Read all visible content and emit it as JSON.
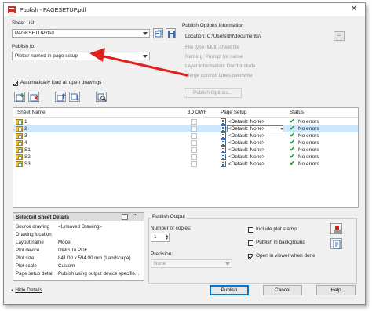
{
  "window": {
    "title": "Publish - PAGESETUP.pdf"
  },
  "sheet_list": {
    "label": "Sheet List:",
    "value": "PAGESETUP.dsd"
  },
  "publish_to": {
    "label": "Publish to:",
    "value": "Plotter named in page setup"
  },
  "auto_load": {
    "label": "Automatically load all open drawings",
    "checked": true
  },
  "publish_options": {
    "title": "Publish Options Information",
    "location": "Location:  C:\\Users\\thl\\documents\\",
    "browse_label": "...",
    "file_type": "File type: Multi-sheet file",
    "naming": "Naming: Prompt for name",
    "layer_info": "Layer information: Don't include",
    "merge_control": "Merge control: Lines overwrite",
    "button_label": "Publish Options..."
  },
  "table": {
    "headers": {
      "sheet_name": "Sheet Name",
      "dwf3d": "3D DWF",
      "page_setup": "Page Setup",
      "status": "Status"
    },
    "rows": [
      {
        "name": "1",
        "page_setup": "<Default: None>",
        "status": "No errors"
      },
      {
        "name": "2",
        "page_setup": "<Default: None>",
        "status": "No errors"
      },
      {
        "name": "3",
        "page_setup": "<Default: None>",
        "status": "No errors"
      },
      {
        "name": "4",
        "page_setup": "<Default: None>",
        "status": "No errors"
      },
      {
        "name": "S1",
        "page_setup": "<Default: None>",
        "status": "No errors"
      },
      {
        "name": "S2",
        "page_setup": "<Default: None>",
        "status": "No errors"
      },
      {
        "name": "S3",
        "page_setup": "<Default: None>",
        "status": "No errors"
      }
    ],
    "selected_row": 1
  },
  "details": {
    "title": "Selected Sheet Details",
    "rows": [
      {
        "key": "Source drawing",
        "value": "<Unsaved Drawing>"
      },
      {
        "key": "Drawing location",
        "value": ""
      },
      {
        "key": "Layout name",
        "value": "Model"
      },
      {
        "key": "Plot device",
        "value": "DWG To PDF"
      },
      {
        "key": "Plot size",
        "value": "841.00 x 594.00 mm (Landscape)"
      },
      {
        "key": "Plot scale",
        "value": "Custom"
      },
      {
        "key": "Page setup detail",
        "value": "Publish using output device specifie..."
      }
    ]
  },
  "publish_output": {
    "title": "Publish Output",
    "copies_label": "Number of copies:",
    "copies_value": "1",
    "precision_label": "Precision:",
    "precision_value": "None",
    "plot_stamp": {
      "label": "Include plot stamp",
      "checked": false
    },
    "background": {
      "label": "Publish in background",
      "checked": false
    },
    "open_viewer": {
      "label": "Open in viewer when done",
      "checked": true
    }
  },
  "footer": {
    "hide_details": "Hide Details",
    "publish": "Publish",
    "cancel": "Cancel",
    "help": "Help"
  },
  "colors": {
    "annotation_arrow": "#e0201d",
    "status_ok": "#1f9e3a",
    "selection": "#cce8ff"
  }
}
